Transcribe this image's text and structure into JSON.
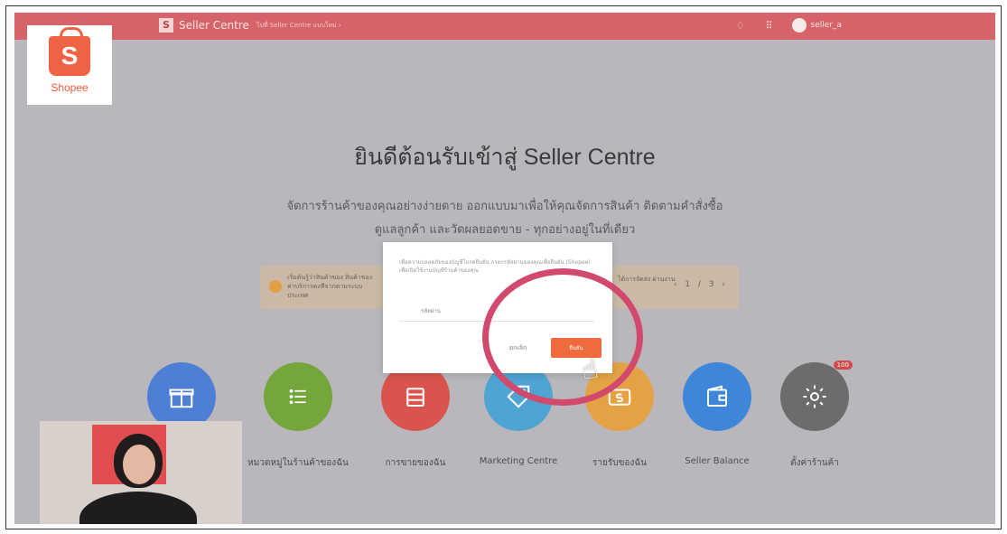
{
  "header": {
    "brand_mark": "S",
    "title": "Seller Centre",
    "subtitle": "ไปที่ Seller Centre แบบใหม่ ›",
    "username": "seller_a"
  },
  "logo": {
    "mark": "S",
    "name": "Shopee"
  },
  "welcome": {
    "title": "ยินดีต้อนรับเข้าสู่ Seller Centre",
    "line1": "จัดการร้านค้าของคุณอย่างง่ายดาย ออกแบบมาเพื่อให้คุณจัดการสินค้า ติดตามคำสั่งซื้อ",
    "line2": "ดูแลลูกค้า และวัดผลยอดขาย - ทุกอย่างอยู่ในที่เดียว"
  },
  "notice": {
    "text_left": "เริ่มต้นรู้ว่าสินค้าของ สินค้าของ ค่าบริการคงทีจากตามระบบ ประเทศ",
    "text_right": "ได้การจัดส่ง ผ่านงาน",
    "pager": "‹ 1 / 3 ›"
  },
  "modal": {
    "message": "เพื่อความปลอดภัยของบัญชีโปรดยืนยัน กรอกรหัสผ่านของคุณเพื่อยืนยัน (Shopee) เพื่อเปิดใช้งานบัญชีร้านค้าของคุณ",
    "input_placeholder": "รหัสผ่าน",
    "cancel_label": "ยกเลิก",
    "confirm_label": "ยืนยัน"
  },
  "features": [
    {
      "label": "",
      "icon": "gift-icon",
      "color": "#4d7fd6"
    },
    {
      "label": "หมวดหมู่ในร้านค้าของฉัน",
      "icon": "list-icon",
      "color": "#74a63c"
    },
    {
      "label": "การขายของฉัน",
      "icon": "box-icon",
      "color": "#d8544c"
    },
    {
      "label": "Marketing Centre",
      "icon": "tag-icon",
      "color": "#4fa4d4"
    },
    {
      "label": "รายรับของฉัน",
      "icon": "wallet-s-icon",
      "color": "#e5a245"
    },
    {
      "label": "Seller Balance",
      "icon": "wallet-icon",
      "color": "#3d86d9"
    },
    {
      "label": "ตั้งค่าร้านค้า",
      "icon": "gear-icon",
      "color": "#6c6c6c",
      "badge": "100"
    }
  ],
  "colors": {
    "header": "#d7636a",
    "accent": "#ef6a3d",
    "annotation": "#d14a6d"
  }
}
